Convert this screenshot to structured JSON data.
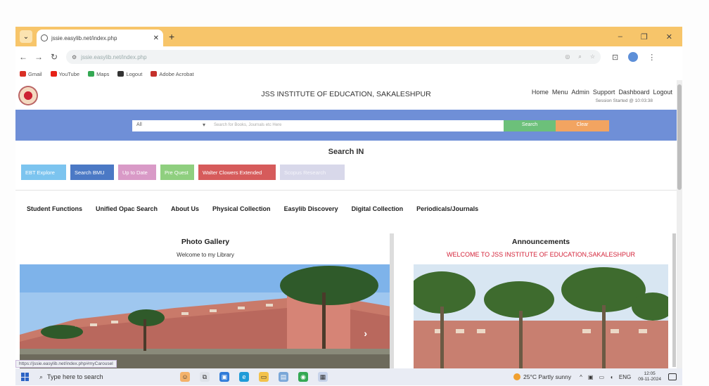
{
  "browser": {
    "tab_title": "jssie.easylib.net/index.php",
    "url": "jssie.easylib.net/index.php",
    "bookmarks": [
      {
        "label": "Gmail",
        "color": "#d93025"
      },
      {
        "label": "YouTube",
        "color": "#e62117"
      },
      {
        "label": "Maps",
        "color": "#34a853"
      },
      {
        "label": "Logout",
        "color": "#333333"
      },
      {
        "label": "Adobe Acrobat",
        "color": "#c4302b"
      }
    ],
    "status_url": "https://jssie.easylib.net/index.php#myCarousel"
  },
  "site": {
    "title": "JSS INSTITUTE OF EDUCATION, SAKALESHPUR",
    "top_links": [
      "Home",
      "Menu",
      "Admin",
      "Support",
      "Dashboard",
      "Logout"
    ],
    "session": "Session Started @ 10:03:38"
  },
  "search": {
    "select_value": "All",
    "placeholder": "Search for Books, Journals etc Here",
    "search_label": "Search",
    "clear_label": "Clear",
    "heading": "Search IN",
    "sources": [
      "EBT Explore",
      "Search BMU",
      "Up to Date",
      "Pre Quest",
      "Walter Clowers Extended",
      "Scopus Research"
    ]
  },
  "nav": [
    "Student Functions",
    "Unified Opac Search",
    "About Us",
    "Physical Collection",
    "Easylib Discovery",
    "Digital Collection",
    "Periodicals/Journals"
  ],
  "gallery": {
    "title": "Photo Gallery",
    "subtitle": "Welcome to my Library"
  },
  "announcements": {
    "title": "Announcements",
    "subtitle": "WELCOME TO JSS INSTITUTE OF EDUCATION,SAKALESHPUR"
  },
  "taskbar": {
    "search_placeholder": "Type here to search",
    "weather": "25°C  Partly sunny",
    "lang": "ENG",
    "time": "12:05",
    "date": "09-11-2024"
  }
}
